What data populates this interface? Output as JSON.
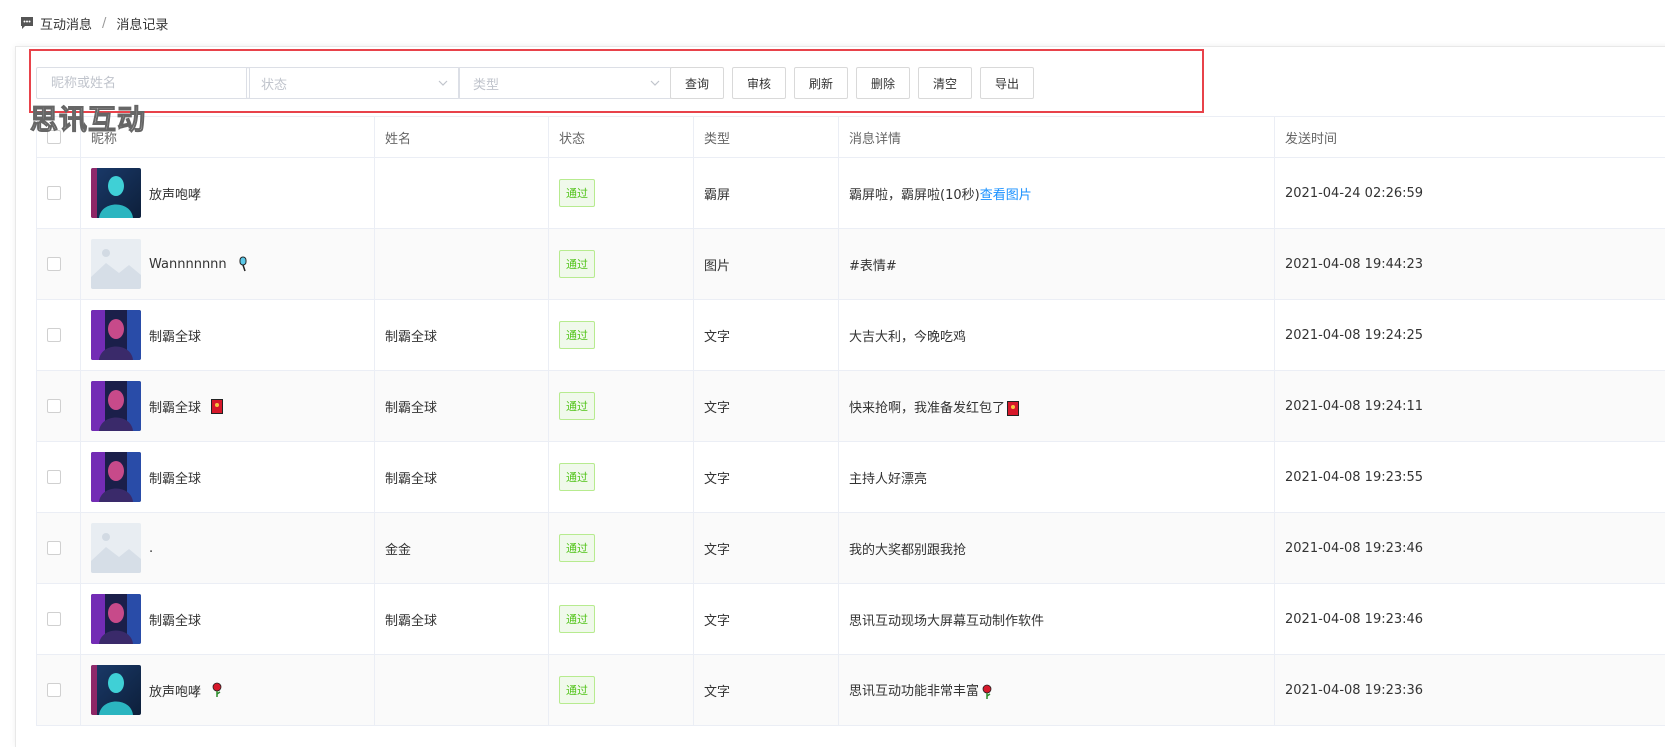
{
  "breadcrumb": {
    "items": [
      "互动消息",
      "消息记录"
    ],
    "separator": "/"
  },
  "toolbar": {
    "search_placeholder": "昵称或姓名",
    "status_placeholder": "状态",
    "type_placeholder": "类型",
    "buttons": [
      "查询",
      "审核",
      "刷新",
      "删除",
      "清空",
      "导出"
    ]
  },
  "watermark": "思讯互动",
  "table": {
    "columns": [
      "昵称",
      "姓名",
      "状态",
      "类型",
      "消息详情",
      "发送时间"
    ],
    "rows": [
      {
        "nickname": "放声咆哮",
        "name": "",
        "status": "通过",
        "type": "霸屏",
        "message": "霸屏啦，霸屏啦(10秒)",
        "link": "查看图片",
        "emoji": "",
        "time": "2021-04-24 02:26:59",
        "avatar": "avatar-1"
      },
      {
        "nickname": "Wannnnnnn",
        "name": "",
        "status": "通过",
        "type": "图片",
        "message": "#表情#",
        "link": "",
        "emoji": "microphone",
        "time": "2021-04-08 19:44:23",
        "avatar": "placeholder"
      },
      {
        "nickname": "制霸全球",
        "name": "制霸全球",
        "status": "通过",
        "type": "文字",
        "message": "大吉大利，今晚吃鸡",
        "link": "",
        "emoji": "",
        "time": "2021-04-08 19:24:25",
        "avatar": "avatar-2"
      },
      {
        "nickname": "制霸全球",
        "name": "制霸全球",
        "status": "通过",
        "type": "文字",
        "message": "快来抢啊，我准备发红包了",
        "link": "",
        "emoji": "red-envelope",
        "time": "2021-04-08 19:24:11",
        "avatar": "avatar-2"
      },
      {
        "nickname": "制霸全球",
        "name": "制霸全球",
        "status": "通过",
        "type": "文字",
        "message": "主持人好漂亮",
        "link": "",
        "emoji": "",
        "time": "2021-04-08 19:23:55",
        "avatar": "avatar-2"
      },
      {
        "nickname": ".",
        "name": "金金",
        "status": "通过",
        "type": "文字",
        "message": "我的大奖都别跟我抢",
        "link": "",
        "emoji": "",
        "time": "2021-04-08 19:23:46",
        "avatar": "placeholder"
      },
      {
        "nickname": "制霸全球",
        "name": "制霸全球",
        "status": "通过",
        "type": "文字",
        "message": "思讯互动现场大屏幕互动制作软件",
        "link": "",
        "emoji": "",
        "time": "2021-04-08 19:23:46",
        "avatar": "avatar-2"
      },
      {
        "nickname": "放声咆哮",
        "name": "",
        "status": "通过",
        "type": "文字",
        "message": "思讯互动功能非常丰富",
        "link": "",
        "emoji": "rose",
        "time": "2021-04-08 19:23:36",
        "avatar": "avatar-1"
      }
    ]
  },
  "colors": {
    "accent_link": "#1890ff",
    "status_green": "#52c41a",
    "highlight_border": "#e8424a"
  }
}
